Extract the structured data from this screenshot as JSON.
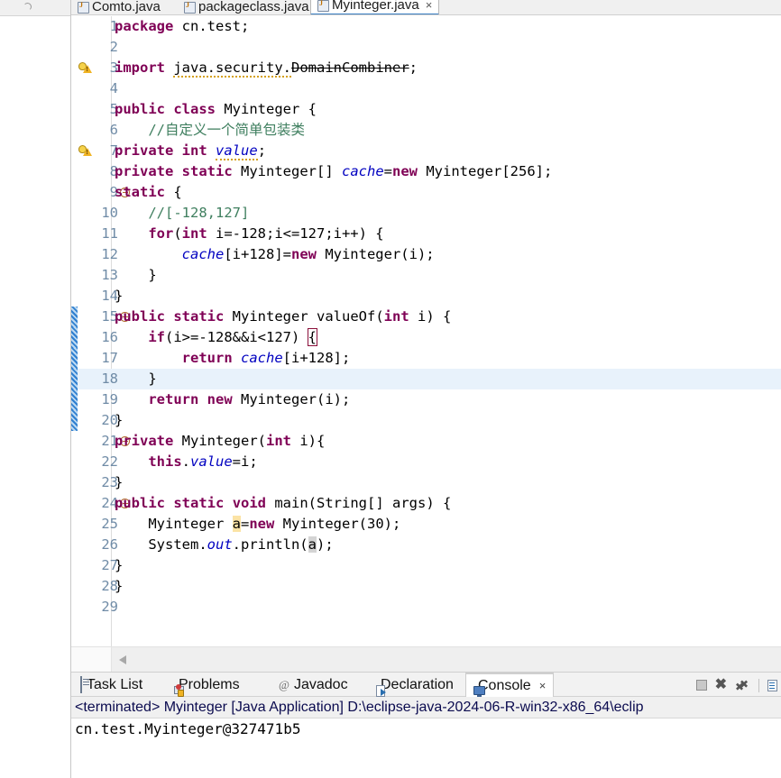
{
  "window": {
    "title": "Eclipse IDE - Myinteger.java"
  },
  "left_panel": {
    "collapse_icon": "circle-chevron-icon"
  },
  "editor": {
    "tabs": [
      {
        "label": "Comto.java",
        "icon": "java-file-icon",
        "active": false,
        "closable": false
      },
      {
        "label": "packageclass.java",
        "icon": "java-file-icon",
        "active": false,
        "closable": false
      },
      {
        "label": "Myinteger.java",
        "icon": "java-file-icon",
        "active": true,
        "closable": true,
        "close_glyph": "×"
      }
    ],
    "scrollbar": {
      "left_arrow": "scroll-left-arrow-icon"
    },
    "lines": [
      {
        "n": "1",
        "marker": null,
        "fold": false,
        "change": false,
        "highlight": false,
        "tokens": [
          {
            "t": "package",
            "c": "kw"
          },
          {
            "t": " cn.test;",
            "c": "plain"
          }
        ]
      },
      {
        "n": "2",
        "marker": null,
        "fold": false,
        "change": false,
        "highlight": false,
        "tokens": []
      },
      {
        "n": "3",
        "marker": "warning",
        "fold": false,
        "change": false,
        "highlight": false,
        "tokens": [
          {
            "t": "import",
            "c": "kw"
          },
          {
            "t": " ",
            "c": "plain"
          },
          {
            "t": "java.security.",
            "c": "spell"
          },
          {
            "t": "DomainCombiner",
            "c": "depr"
          },
          {
            "t": ";",
            "c": "plain"
          }
        ]
      },
      {
        "n": "4",
        "marker": null,
        "fold": false,
        "change": false,
        "highlight": false,
        "tokens": []
      },
      {
        "n": "5",
        "marker": null,
        "fold": false,
        "change": false,
        "highlight": false,
        "tokens": [
          {
            "t": "public",
            "c": "kw"
          },
          {
            "t": " ",
            "c": "plain"
          },
          {
            "t": "class",
            "c": "kw"
          },
          {
            "t": " Myinteger {",
            "c": "plain"
          }
        ]
      },
      {
        "n": "6",
        "marker": null,
        "fold": false,
        "change": false,
        "highlight": false,
        "tokens": [
          {
            "t": "    //自定义一个简单包装类",
            "c": "cmt"
          }
        ]
      },
      {
        "n": "7",
        "marker": "warning",
        "fold": false,
        "change": false,
        "highlight": false,
        "tokens": [
          {
            "t": "private",
            "c": "kw"
          },
          {
            "t": " ",
            "c": "plain"
          },
          {
            "t": "int",
            "c": "kw"
          },
          {
            "t": " ",
            "c": "plain"
          },
          {
            "t": "value",
            "c": "fld-spell"
          },
          {
            "t": ";",
            "c": "plain"
          }
        ]
      },
      {
        "n": "8",
        "marker": null,
        "fold": false,
        "change": false,
        "highlight": false,
        "tokens": [
          {
            "t": "private",
            "c": "kw"
          },
          {
            "t": " ",
            "c": "plain"
          },
          {
            "t": "static",
            "c": "kw"
          },
          {
            "t": " Myinteger[] ",
            "c": "plain"
          },
          {
            "t": "cache",
            "c": "stat"
          },
          {
            "t": "=",
            "c": "plain"
          },
          {
            "t": "new",
            "c": "kw"
          },
          {
            "t": " Myinteger[256];",
            "c": "plain"
          }
        ]
      },
      {
        "n": "9",
        "marker": null,
        "fold": true,
        "change": false,
        "highlight": false,
        "tokens": [
          {
            "t": "static",
            "c": "kw"
          },
          {
            "t": " {",
            "c": "plain"
          }
        ]
      },
      {
        "n": "10",
        "marker": null,
        "fold": false,
        "change": false,
        "highlight": false,
        "tokens": [
          {
            "t": "    //[-128,127]",
            "c": "cmt"
          }
        ]
      },
      {
        "n": "11",
        "marker": null,
        "fold": false,
        "change": false,
        "highlight": false,
        "tokens": [
          {
            "t": "    ",
            "c": "plain"
          },
          {
            "t": "for",
            "c": "kw"
          },
          {
            "t": "(",
            "c": "plain"
          },
          {
            "t": "int",
            "c": "kw"
          },
          {
            "t": " i=-128;i<=127;i++) {",
            "c": "plain"
          }
        ]
      },
      {
        "n": "12",
        "marker": null,
        "fold": false,
        "change": false,
        "highlight": false,
        "tokens": [
          {
            "t": "        ",
            "c": "plain"
          },
          {
            "t": "cache",
            "c": "stat"
          },
          {
            "t": "[i+128]=",
            "c": "plain"
          },
          {
            "t": "new",
            "c": "kw"
          },
          {
            "t": " Myinteger(i);",
            "c": "plain"
          }
        ]
      },
      {
        "n": "13",
        "marker": null,
        "fold": false,
        "change": false,
        "highlight": false,
        "tokens": [
          {
            "t": "    }",
            "c": "plain"
          }
        ]
      },
      {
        "n": "14",
        "marker": null,
        "fold": false,
        "change": false,
        "highlight": false,
        "tokens": [
          {
            "t": "}",
            "c": "plain"
          }
        ]
      },
      {
        "n": "15",
        "marker": null,
        "fold": true,
        "change": true,
        "highlight": false,
        "tokens": [
          {
            "t": "public",
            "c": "kw"
          },
          {
            "t": " ",
            "c": "plain"
          },
          {
            "t": "static",
            "c": "kw"
          },
          {
            "t": " Myinteger valueOf(",
            "c": "plain"
          },
          {
            "t": "int",
            "c": "kw"
          },
          {
            "t": " i) {",
            "c": "plain"
          }
        ]
      },
      {
        "n": "16",
        "marker": null,
        "fold": false,
        "change": true,
        "highlight": false,
        "tokens": [
          {
            "t": "    ",
            "c": "plain"
          },
          {
            "t": "if",
            "c": "kw"
          },
          {
            "t": "(i>=-128&&i<127) ",
            "c": "plain"
          },
          {
            "t": "{",
            "c": "brmatch"
          }
        ]
      },
      {
        "n": "17",
        "marker": null,
        "fold": false,
        "change": true,
        "highlight": false,
        "tokens": [
          {
            "t": "        ",
            "c": "plain"
          },
          {
            "t": "return",
            "c": "kw"
          },
          {
            "t": " ",
            "c": "plain"
          },
          {
            "t": "cache",
            "c": "stat"
          },
          {
            "t": "[i+128];",
            "c": "plain"
          }
        ]
      },
      {
        "n": "18",
        "marker": null,
        "fold": false,
        "change": true,
        "highlight": true,
        "tokens": [
          {
            "t": "    }",
            "c": "plain"
          }
        ]
      },
      {
        "n": "19",
        "marker": null,
        "fold": false,
        "change": true,
        "highlight": false,
        "tokens": [
          {
            "t": "    ",
            "c": "plain"
          },
          {
            "t": "return",
            "c": "kw"
          },
          {
            "t": " ",
            "c": "plain"
          },
          {
            "t": "new",
            "c": "kw"
          },
          {
            "t": " Myinteger(i);",
            "c": "plain"
          }
        ]
      },
      {
        "n": "20",
        "marker": null,
        "fold": false,
        "change": true,
        "highlight": false,
        "tokens": [
          {
            "t": "}",
            "c": "plain"
          }
        ]
      },
      {
        "n": "21",
        "marker": null,
        "fold": true,
        "change": false,
        "highlight": false,
        "tokens": [
          {
            "t": "private",
            "c": "kw"
          },
          {
            "t": " Myinteger(",
            "c": "plain"
          },
          {
            "t": "int",
            "c": "kw"
          },
          {
            "t": " i){",
            "c": "plain"
          }
        ]
      },
      {
        "n": "22",
        "marker": null,
        "fold": false,
        "change": false,
        "highlight": false,
        "tokens": [
          {
            "t": "    ",
            "c": "plain"
          },
          {
            "t": "this",
            "c": "kw"
          },
          {
            "t": ".",
            "c": "plain"
          },
          {
            "t": "value",
            "c": "fld"
          },
          {
            "t": "=i;",
            "c": "plain"
          }
        ]
      },
      {
        "n": "23",
        "marker": null,
        "fold": false,
        "change": false,
        "highlight": false,
        "tokens": [
          {
            "t": "}",
            "c": "plain"
          }
        ]
      },
      {
        "n": "24",
        "marker": null,
        "fold": true,
        "change": false,
        "highlight": false,
        "tokens": [
          {
            "t": "public",
            "c": "kw"
          },
          {
            "t": " ",
            "c": "plain"
          },
          {
            "t": "static",
            "c": "kw"
          },
          {
            "t": " ",
            "c": "plain"
          },
          {
            "t": "void",
            "c": "kw"
          },
          {
            "t": " main(String[] args) {",
            "c": "plain"
          }
        ]
      },
      {
        "n": "25",
        "marker": null,
        "fold": false,
        "change": false,
        "highlight": false,
        "tokens": [
          {
            "t": "    Myinteger ",
            "c": "plain"
          },
          {
            "t": "a",
            "c": "occ-w"
          },
          {
            "t": "=",
            "c": "plain"
          },
          {
            "t": "new",
            "c": "kw"
          },
          {
            "t": " Myinteger(30);",
            "c": "plain"
          }
        ]
      },
      {
        "n": "26",
        "marker": null,
        "fold": false,
        "change": false,
        "highlight": false,
        "tokens": [
          {
            "t": "    System.",
            "c": "plain"
          },
          {
            "t": "out",
            "c": "stat"
          },
          {
            "t": ".println(",
            "c": "plain"
          },
          {
            "t": "a",
            "c": "occ-r"
          },
          {
            "t": ");",
            "c": "plain"
          }
        ]
      },
      {
        "n": "27",
        "marker": null,
        "fold": false,
        "change": false,
        "highlight": false,
        "tokens": [
          {
            "t": "}",
            "c": "plain"
          }
        ]
      },
      {
        "n": "28",
        "marker": null,
        "fold": false,
        "change": false,
        "highlight": false,
        "tokens": [
          {
            "t": "}",
            "c": "plain"
          }
        ]
      },
      {
        "n": "29",
        "marker": null,
        "fold": false,
        "change": false,
        "highlight": false,
        "tokens": []
      }
    ]
  },
  "bottom_panel": {
    "tabs": [
      {
        "label": "Task List",
        "icon": "task-list-icon",
        "active": false,
        "closable": false
      },
      {
        "label": "Problems",
        "icon": "problems-icon",
        "active": false,
        "closable": false
      },
      {
        "label": "Javadoc",
        "icon": "javadoc-at-icon",
        "active": false,
        "closable": false
      },
      {
        "label": "Declaration",
        "icon": "declaration-icon",
        "active": false,
        "closable": false
      },
      {
        "label": "Console",
        "icon": "console-icon",
        "active": true,
        "closable": true,
        "close_glyph": "×"
      }
    ],
    "toolbar": [
      {
        "name": "terminate-button",
        "icon": "stop-square-icon"
      },
      {
        "name": "remove-launch-button",
        "icon": "x-icon"
      },
      {
        "name": "remove-all-terminated-button",
        "icon": "double-x-icon"
      },
      {
        "name": "toolbar-separator",
        "icon": "separator"
      },
      {
        "name": "pin-console-button",
        "icon": "pin-console-icon"
      }
    ],
    "console": {
      "header": "<terminated> Myinteger [Java Application] D:\\eclipse-java-2024-06-R-win32-x86_64\\eclip",
      "output": "cn.test.Myinteger@327471b5"
    }
  },
  "colors": {
    "keyword": "#7f0055",
    "comment": "#3f7f5f",
    "field": "#0000c0",
    "highlight_line": "#e8f2fb",
    "change_bar": "#2f7fd0",
    "occurrence_write": "#fbe3a5",
    "occurrence_read": "#d4d4d4",
    "tab_active_underline": "#3b7fc4"
  }
}
